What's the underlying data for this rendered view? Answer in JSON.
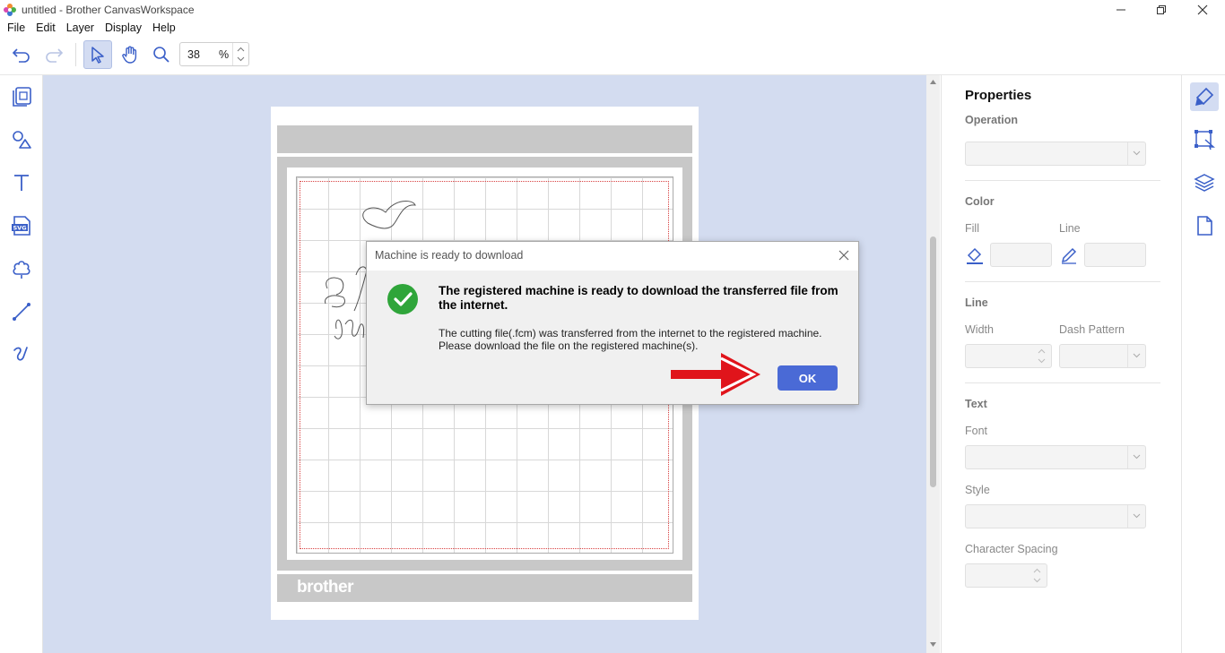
{
  "window": {
    "title": "untitled - Brother CanvasWorkspace",
    "minimize_icon": "minimize-icon",
    "restore_icon": "restore-icon",
    "close_icon": "close-icon"
  },
  "menu": {
    "items": [
      "File",
      "Edit",
      "Layer",
      "Display",
      "Help"
    ]
  },
  "toolbar": {
    "zoom_value": "38",
    "zoom_unit": "%"
  },
  "left_tools": [
    "pages-icon",
    "shapes-icon",
    "text-icon",
    "svg-import-icon",
    "cloud-shape-icon",
    "line-icon",
    "freehand-icon"
  ],
  "canvas": {
    "brand": "brother"
  },
  "properties": {
    "title": "Properties",
    "operation_label": "Operation",
    "color_label": "Color",
    "fill_label": "Fill",
    "line_label": "Line",
    "line_section_label": "Line",
    "width_label": "Width",
    "dash_pattern_label": "Dash Pattern",
    "text_label": "Text",
    "font_label": "Font",
    "style_label": "Style",
    "char_spacing_label": "Character Spacing"
  },
  "right_tools": [
    "edit-brush-icon",
    "transform-select-icon",
    "layers-icon",
    "page-icon"
  ],
  "dialog": {
    "title": "Machine is ready to download",
    "heading": "The registered machine is ready to download the transferred file from the internet.",
    "message_line1": "The cutting file(.fcm) was transferred from the internet to the registered machine.",
    "message_line2": "Please download the file on the registered machine(s).",
    "ok_label": "OK"
  },
  "colors": {
    "accent": "#4a6ad6",
    "canvas_bg": "#d3dcf0",
    "success": "#2fa53a",
    "annotation_arrow": "#e0141b"
  }
}
